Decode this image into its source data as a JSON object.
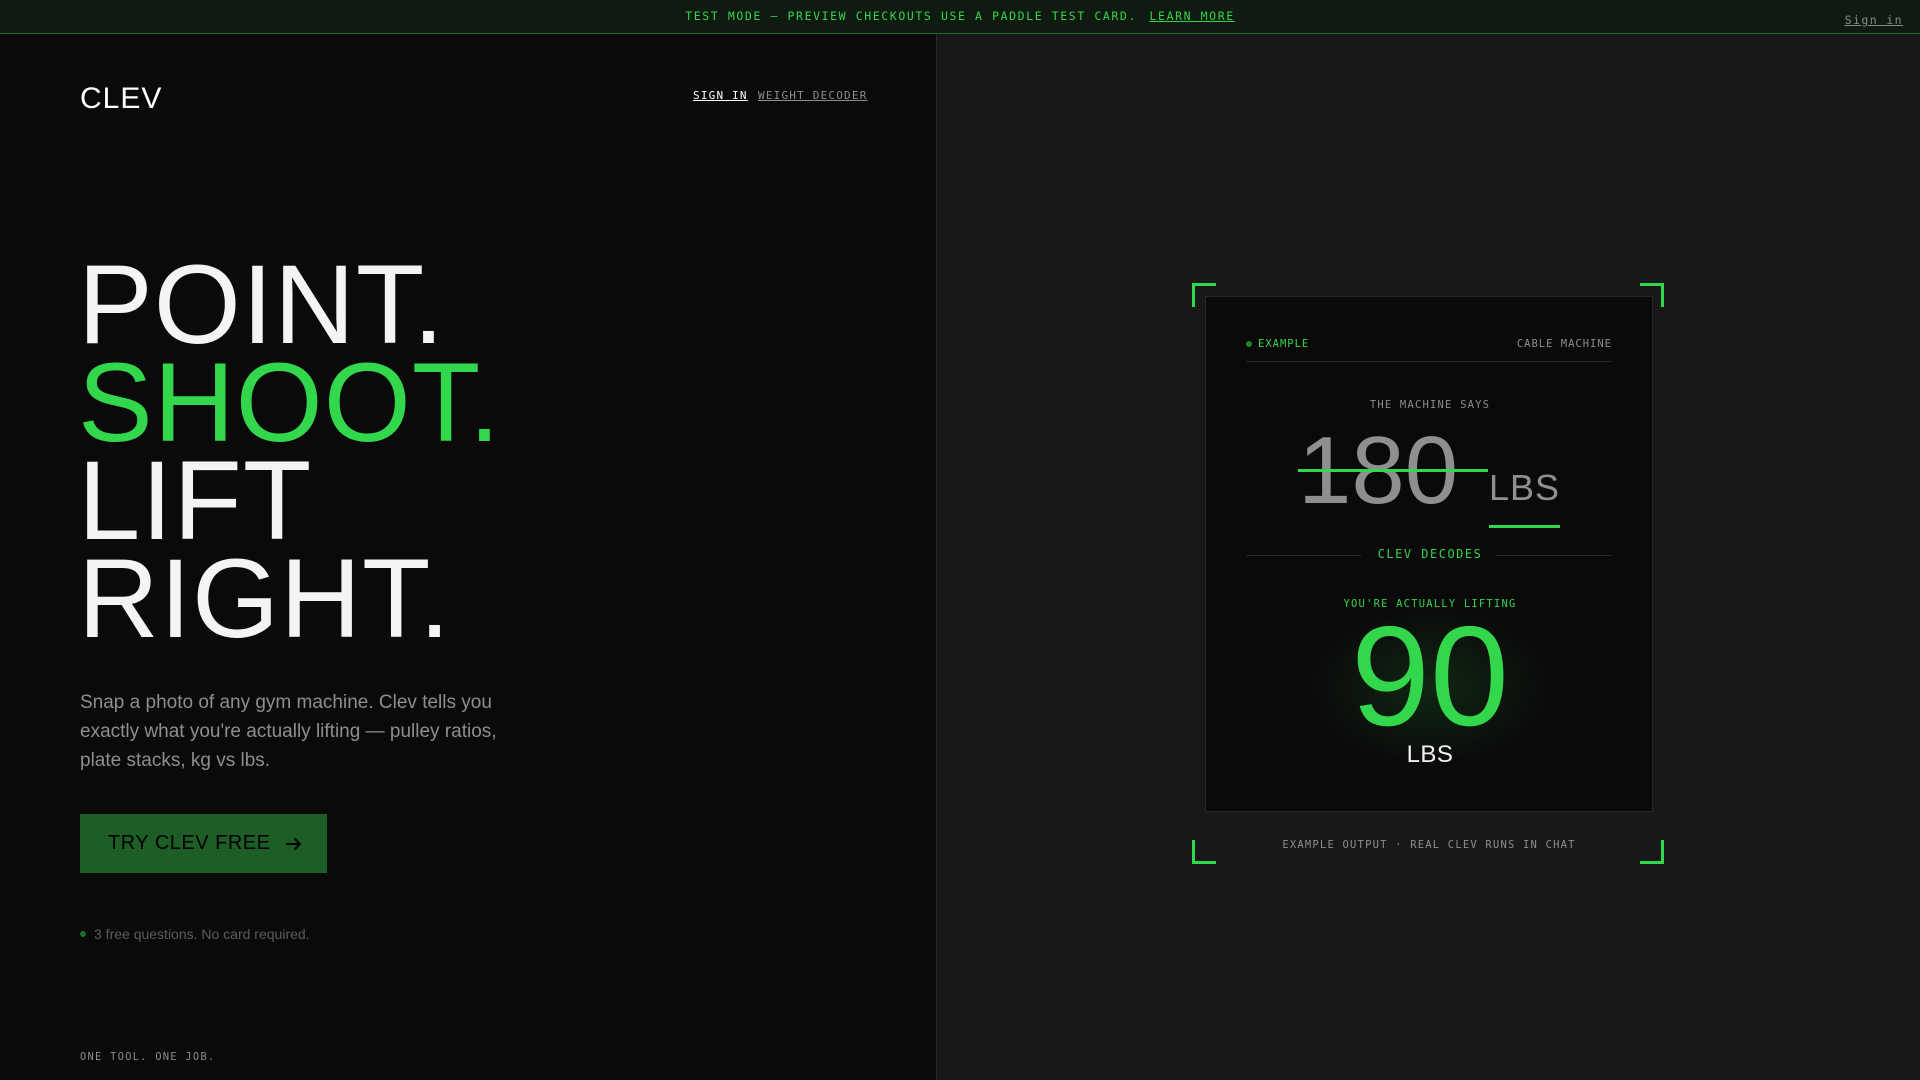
{
  "banner": {
    "message": "TEST MODE — PREVIEW CHECKOUTS USE A PADDLE TEST CARD.",
    "link_label": "LEARN MORE",
    "signin_label": "Sign in"
  },
  "header": {
    "logo": "CLEV",
    "nav": [
      "SIGN IN",
      "WEIGHT DECODER"
    ]
  },
  "hero": {
    "lines": [
      "POINT.",
      "SHOOT.",
      "LIFT",
      "RIGHT."
    ],
    "subtitle": "Snap a photo of any gym machine. Clev tells you exactly what you're actually lifting — pulley ratios, plate stacks, kg vs lbs.",
    "cta_label": "TRY CLEV FREE",
    "note": "3 free questions. No card required."
  },
  "footer": {
    "tagline": "ONE TOOL. ONE JOB."
  },
  "example_card": {
    "badge": "EXAMPLE",
    "machine": "CABLE MACHINE",
    "says_label": "THE MACHINE SAYS",
    "stated_value": "180",
    "stated_unit": "LBS",
    "decodes_label": "CLEV DECODES",
    "actual_label": "YOU'RE ACTUALLY LIFTING",
    "actual_value": "90",
    "actual_unit": "LBS",
    "caption": "EXAMPLE OUTPUT · REAL CLEV RUNS IN CHAT"
  },
  "colors": {
    "accent": "#32d74b",
    "cta_bg": "#1c5e25",
    "left_bg": "#0a0a0a",
    "right_bg": "#181818",
    "banner_bg": "#0f1a10"
  },
  "icons": {
    "cta_icon": "arrow-right-icon",
    "status_dot": "dot-icon"
  }
}
